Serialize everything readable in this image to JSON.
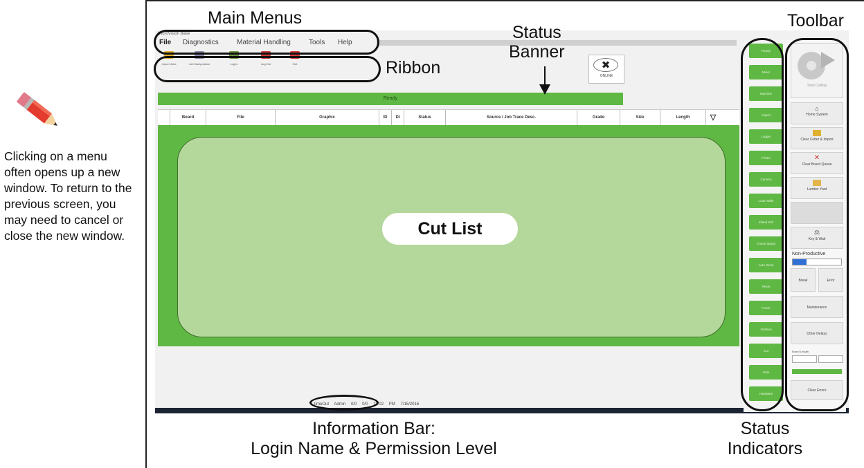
{
  "annotations": {
    "main_menus": "Main Menus",
    "status_banner_1": "Status",
    "status_banner_2": "Banner",
    "ribbon": "Ribbon",
    "toolbar": "Toolbar",
    "info_bar_1": "Information Bar:",
    "info_bar_2": "Login Name & Permission Level",
    "status_indicators_1": "Status",
    "status_indicators_2": "Indicators",
    "cut_list": "Cut List"
  },
  "tip": "Clicking on a menu often opens up a new window. To return to the previous screen, you may need to cancel or close the new window.",
  "app": {
    "title": "MicroVision Base",
    "menus": [
      "File",
      "Diagnostics",
      "Material Handling",
      "Tools",
      "Help"
    ],
    "ribbon": [
      {
        "label": "Import Jobs",
        "icon": "folder-icon",
        "color": "#e0b030"
      },
      {
        "label": "Job Manipulation",
        "icon": "document-icon",
        "color": "#8a8ab0"
      },
      {
        "label": "Log In",
        "icon": "key-icon",
        "color": "#6a9a40"
      },
      {
        "label": "Log Out",
        "icon": "logout-icon",
        "color": "#d03a3a"
      },
      {
        "label": "Exit",
        "icon": "exit-icon",
        "color": "#d83838"
      }
    ],
    "online_label": "ONLINE",
    "banner": "Ready",
    "columns": [
      "Board",
      "File",
      "Graphic",
      "ID",
      "DI",
      "Status",
      "Source / Job Trace Desc.",
      "Grade",
      "Size",
      "Length"
    ],
    "statusbar": [
      "timeOut",
      "Admin",
      "0/0",
      "0/0",
      "12:02 PM",
      "7/15/2016"
    ],
    "indicators": [
      "Ready",
      "Minor",
      "Machine",
      "Import",
      "Logger",
      "Printer",
      "Camera",
      "Load Table",
      "Infeed Roll",
      "Check Stamp",
      "Auto Stock",
      "Reset",
      "Power",
      "Outfeed",
      "Cut",
      "Gate",
      "Hardware"
    ],
    "toolbar": {
      "start": "Start Cutting",
      "home": "Home System",
      "clear_cutter": "Clear Cutter & Import",
      "clear_queue": "Clear Board Queue",
      "lumber_yard": "Lumber Yard",
      "key_wait": "Key & Wait",
      "nonprod_label": "Non-Productive",
      "break": "Break",
      "error": "Error",
      "maintenance": "Maintenance",
      "other": "Other Delays",
      "board_length": "Board Length",
      "clear_errors": "Clear Errors"
    },
    "colors": {
      "green": "#5fb843",
      "light_green": "#b4d89b"
    }
  }
}
